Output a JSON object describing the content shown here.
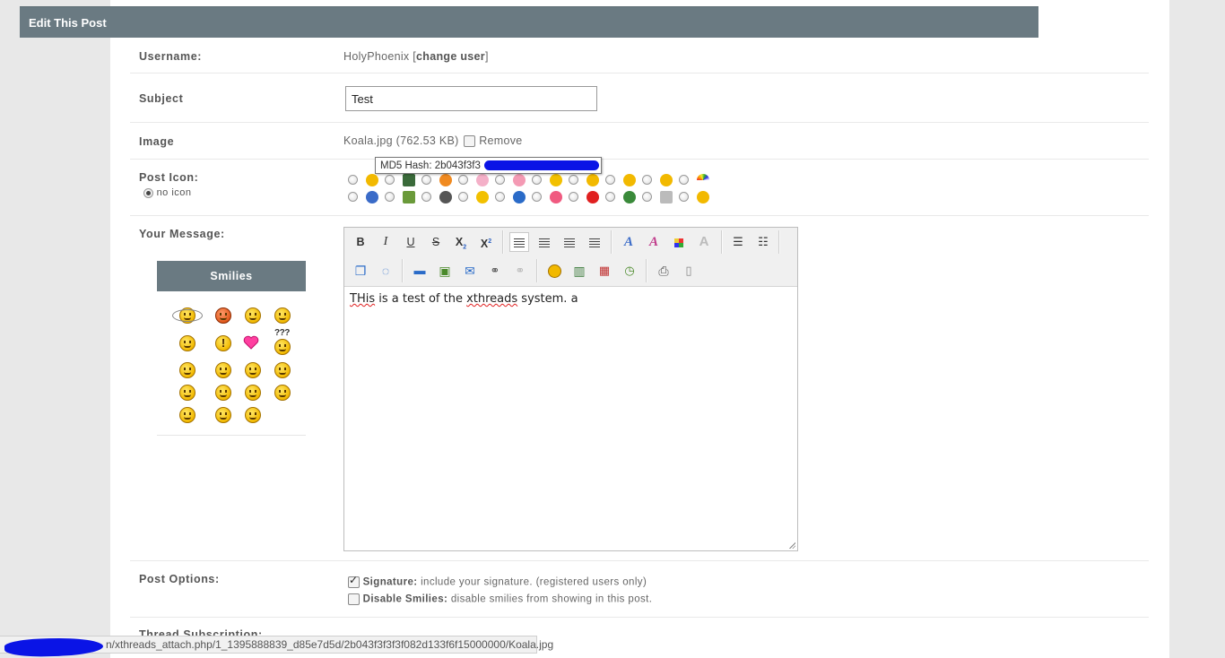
{
  "panel": {
    "title": "Edit This Post"
  },
  "username": {
    "label": "Username:",
    "value": "HolyPhoenix",
    "change_open": " [",
    "change_label": "change user",
    "change_close": "]"
  },
  "subject": {
    "label": "Subject",
    "value": "Test"
  },
  "image": {
    "label": "Image",
    "filename": "Koala.jpg",
    "size": "(762.53 KB)",
    "remove_label": "Remove",
    "tooltip": "MD5 Hash: 2b043f3f3"
  },
  "post_icon": {
    "label": "Post Icon:",
    "no_icon_label": "no icon",
    "row1_icons": [
      "smile-icon",
      "film-icon",
      "thumb-icon",
      "heart-outline-icon",
      "pencil-icon",
      "star-icon",
      "grin-icon",
      "shock-icon",
      "sad-icon",
      "rainbow-icon"
    ],
    "row2_icons": [
      "question-icon",
      "picture-icon",
      "music-icon",
      "lightbulb-icon",
      "info-icon",
      "heart-icon",
      "exclamation-icon",
      "bug-icon",
      "box-icon",
      "laugh-icon"
    ]
  },
  "message": {
    "label": "Your Message:",
    "smilies_label": "Smilies",
    "text_before": "THis",
    "text_mid1": " is a test of the ",
    "text_spell2": "xthreads",
    "text_after": " system.  a",
    "toolbar1": {
      "bold": "B",
      "italic": "I",
      "underline": "U",
      "strike": "S",
      "sub": "X",
      "sup": "X"
    }
  },
  "colors": {
    "header_bg": "#6a7a82",
    "accent_blue": "#0a14e6"
  },
  "post_options": {
    "label": "Post Options:",
    "signature_bold": "Signature:",
    "signature_text": " include your signature. (registered users only)",
    "signature_checked": true,
    "smilies_bold": "Disable Smilies:",
    "smilies_text": " disable smilies from showing in this post.",
    "smilies_checked": false
  },
  "thread_subscription": {
    "label": "Thread Subscription:"
  },
  "status_bar": {
    "url": "n/xthreads_attach.php/1_1395888839_d85e7d5d/2b043f3f3f3f082d133f6f15000000/Koala.jpg"
  }
}
